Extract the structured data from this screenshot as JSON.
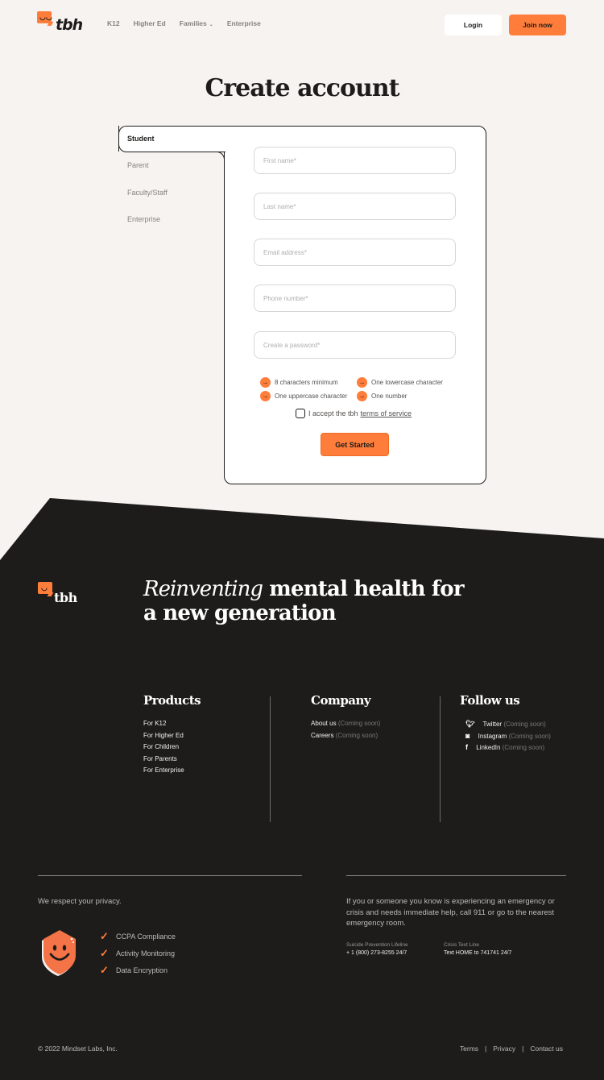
{
  "header": {
    "brand": "tbh",
    "nav": [
      {
        "label": "K12"
      },
      {
        "label": "Higher Ed"
      },
      {
        "label": "Families",
        "has_dropdown": true
      },
      {
        "label": "Enterprise"
      }
    ],
    "login_label": "Login",
    "join_label": "Join now"
  },
  "page_title": "Create account",
  "account_types": {
    "selected": "Student",
    "items": [
      {
        "label": "Student"
      },
      {
        "label": "Parent"
      },
      {
        "label": "Faculty/Staff"
      },
      {
        "label": "Enterprise"
      }
    ]
  },
  "form": {
    "fields": [
      {
        "placeholder": "First name*",
        "value": ""
      },
      {
        "placeholder": "Last name*",
        "value": ""
      },
      {
        "placeholder": "Email address*",
        "value": ""
      },
      {
        "placeholder": "Phone number*",
        "value": ""
      },
      {
        "placeholder": "Create a password*",
        "value": ""
      }
    ],
    "password_requirements": [
      {
        "label": "8 characters minimum",
        "icon": "arrow-right-icon"
      },
      {
        "label": "One lowercase character",
        "icon": "arrow-right-icon"
      },
      {
        "label": "One uppercase character",
        "icon": "arrow-right-icon"
      },
      {
        "label": "One number",
        "icon": "arrow-right-icon"
      }
    ],
    "tos_prefix": "I accept the tbh",
    "tos_link": "terms of service",
    "tos_checked": false,
    "submit_label": "Get Started"
  },
  "footer": {
    "brand": "tbh",
    "tagline_script": "Reinventing",
    "tagline_rest": " mental health for a new generation",
    "columns": {
      "products": {
        "title": "Products",
        "links": [
          "For K12",
          "For Higher Ed",
          "For Children",
          "For Parents",
          "For Enterprise"
        ]
      },
      "company": {
        "title": "Company",
        "links": [
          {
            "label": "About us",
            "note": "(Coming soon)"
          },
          {
            "label": "Careers",
            "note": "(Coming soon)"
          }
        ]
      },
      "follow": {
        "title": "Follow us",
        "links": [
          {
            "label": "Twitter",
            "note": "(Coming soon)",
            "icon": "twitter-icon"
          },
          {
            "label": "Instagram",
            "note": "(Coming soon)",
            "icon": "instagram-icon"
          },
          {
            "label": "LinkedIn",
            "note": "(Coming soon)",
            "icon": "facebook-icon"
          }
        ]
      }
    },
    "privacy": {
      "heading": "We respect your privacy.",
      "items": [
        "CCPA Compliance",
        "Activity Monitoring",
        "Data Encryption"
      ]
    },
    "emergency": {
      "text": "If you or someone you know is experiencing an emergency or crisis and needs immediate help, call 911 or go to the nearest emergency room.",
      "hotlines": [
        {
          "label": "Suicide Prevention Lifeline",
          "value": "+ 1 (800) 273-8255 24/7"
        },
        {
          "label": "Crisis Text Line",
          "value": "Text HOME to 741741 24/7"
        }
      ]
    },
    "copyright": "© 2022 Mindset Labs, Inc.",
    "legal_links": [
      "Terms",
      "Privacy",
      "Contact us"
    ],
    "separator": "|"
  },
  "colors": {
    "accent": "#fe7d3b",
    "background": "#f7f3f0",
    "dark": "#1d1c1a"
  }
}
